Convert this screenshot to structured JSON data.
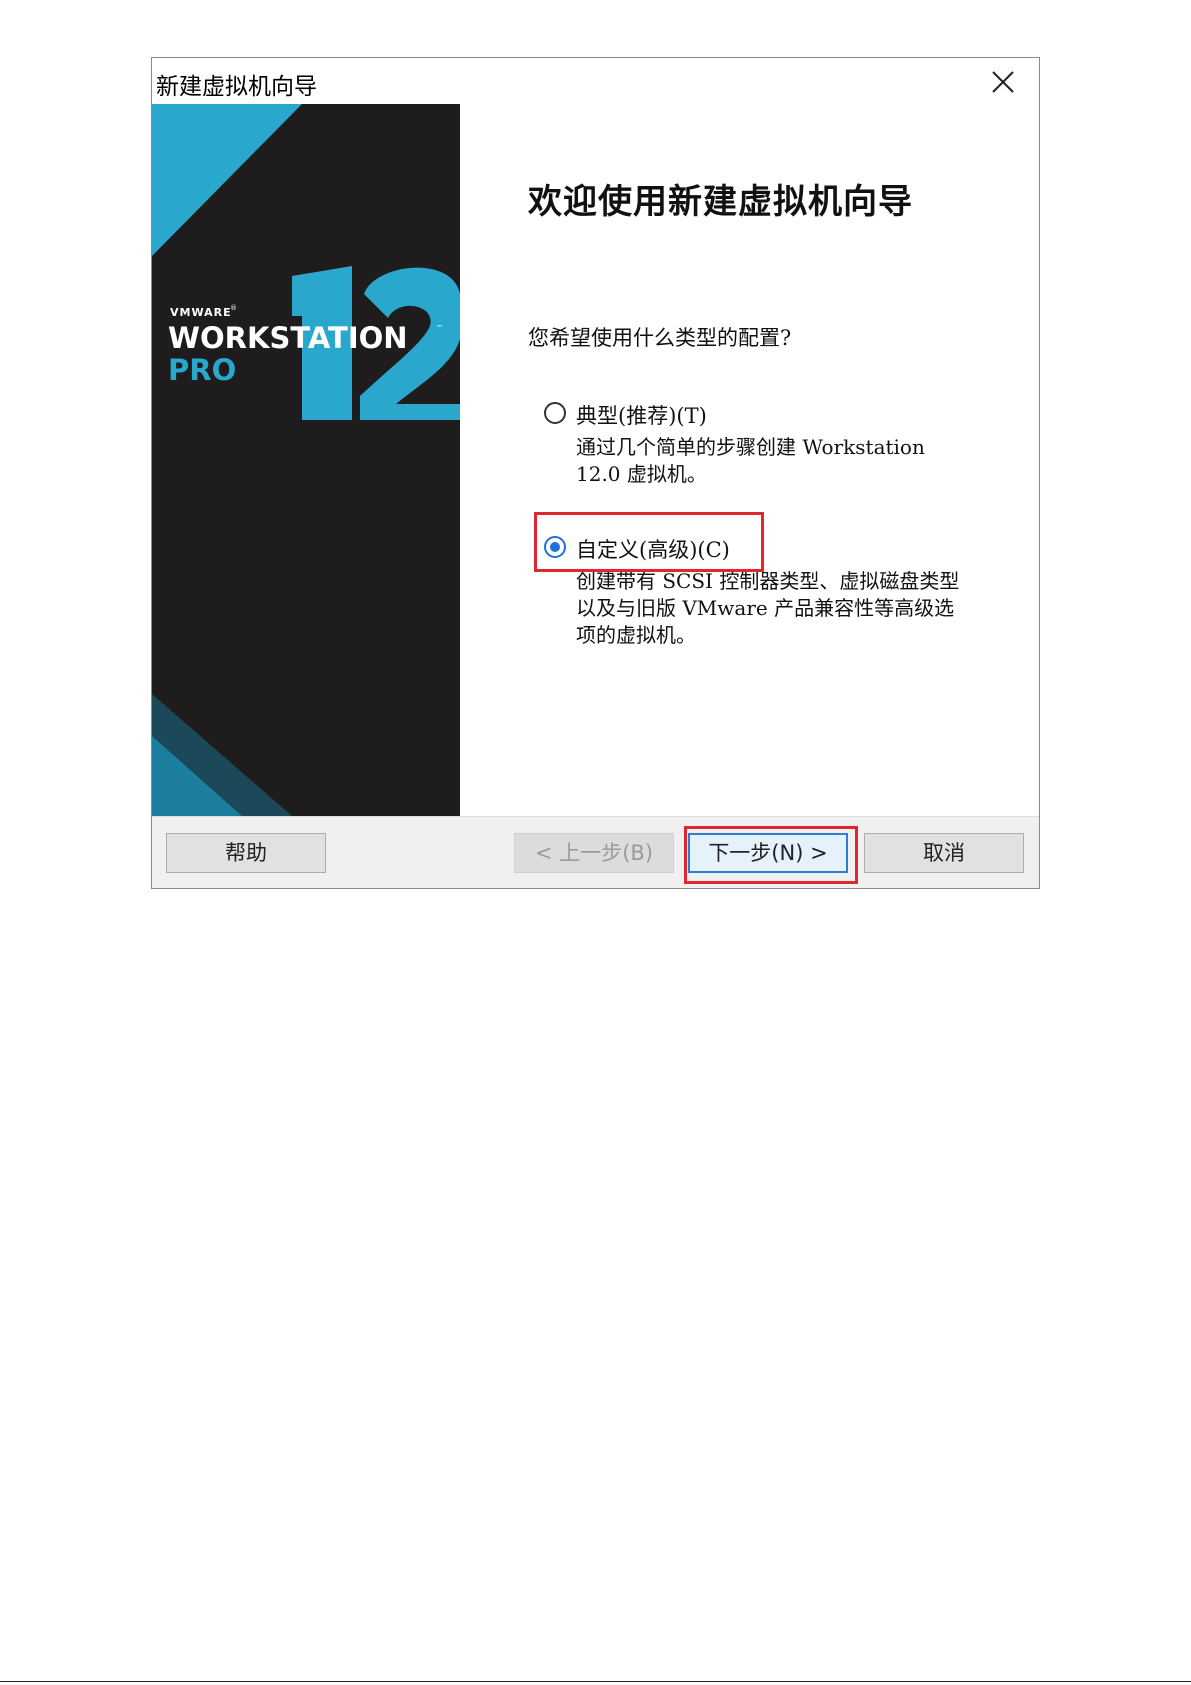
{
  "window": {
    "title": "新建虚拟机向导"
  },
  "banner": {
    "brand": "VMWARE",
    "brand_mark": "®",
    "product": "WORKSTATION",
    "product_mark": "™",
    "edition": "PRO",
    "version": "12",
    "colors": {
      "background": "#1e1c1d",
      "accent": "#29a7cc",
      "accent_dark": "#1c7f9e"
    }
  },
  "content": {
    "heading": "欢迎使用新建虚拟机向导",
    "question": "您希望使用什么类型的配置?",
    "options": [
      {
        "label": "典型(推荐)(T)",
        "description": "通过几个简单的步骤创建 Workstation\n12.0 虚拟机。",
        "checked": false
      },
      {
        "label": "自定义(高级)(C)",
        "description": "创建带有 SCSI 控制器类型、虚拟磁盘类型\n以及与旧版 VMware 产品兼容性等高级选\n项的虚拟机。",
        "checked": true
      }
    ]
  },
  "buttons": {
    "help": "帮助",
    "back": "< 上一步(B)",
    "next": "下一步(N) >",
    "cancel": "取消"
  },
  "icons": {
    "close": "close-icon"
  },
  "annotation_color": "#e0262e"
}
